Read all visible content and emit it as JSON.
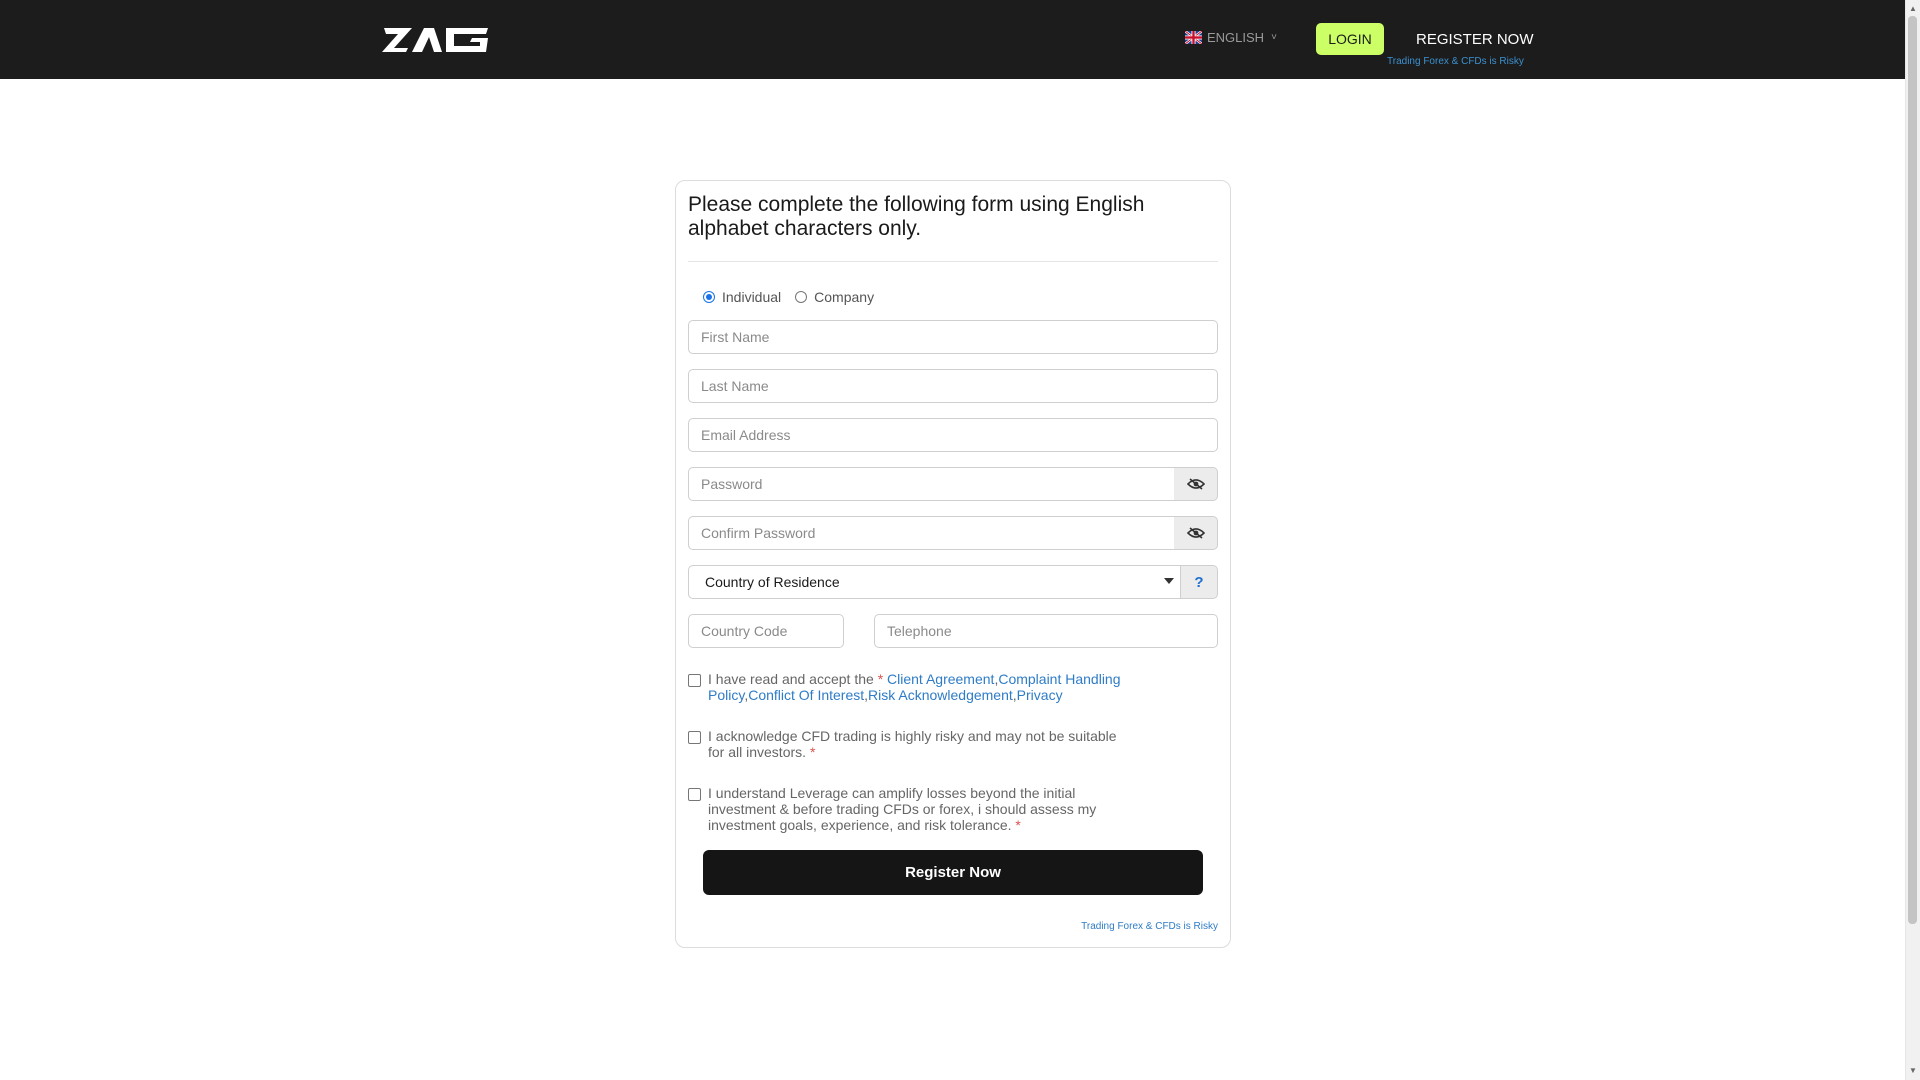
{
  "header": {
    "logo_text": "ZAG",
    "language": "ENGLISH",
    "login": "LOGIN",
    "register": "REGISTER NOW",
    "risk_warning": "Trading Forex & CFDs is Risky"
  },
  "form": {
    "title": "Please complete the following form using English alphabet characters only.",
    "account_types": {
      "individual": "Individual",
      "company": "Company",
      "selected": "Individual"
    },
    "placeholders": {
      "first_name": "First Name",
      "last_name": "Last Name",
      "email": "Email Address",
      "password": "Password",
      "confirm_password": "Confirm Password",
      "country": "Country of Residence",
      "country_code": "Country Code",
      "telephone": "Telephone"
    },
    "help_symbol": "?",
    "consents": {
      "agreement_prefix": "I have read and accept the",
      "asterisk": "*",
      "client_agreement": "Client Agreement",
      "complaint_policy": "Complaint Handling Policy",
      "conflict_of_interest": "Conflict Of Interest",
      "risk_acknowledgement": "Risk Acknowledgement",
      "privacy": "Privacy",
      "cfd_risk": "I acknowledge CFD trading is highly risky and may not be suitable for all investors.",
      "leverage": "I understand Leverage can amplify losses beyond the initial investment & before trading CFDs or forex, i should assess my investment goals, experience, and risk tolerance."
    },
    "submit": "Register Now",
    "risk_warning": "Trading Forex & CFDs is Risky"
  },
  "colors": {
    "header_bg": "#1c1c1c",
    "accent_login": "#ccff66",
    "link": "#2e7cc7",
    "required": "#d9534f",
    "submit_bg": "#151515"
  },
  "icons": [
    "logo",
    "uk-flag-icon",
    "chevron-down-icon",
    "eye-slash-icon",
    "question-icon"
  ]
}
